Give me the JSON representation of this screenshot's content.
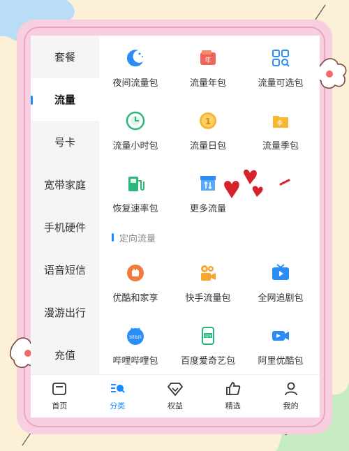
{
  "sidebar": {
    "items": [
      {
        "label": "套餐",
        "active": false
      },
      {
        "label": "流量",
        "active": true
      },
      {
        "label": "号卡",
        "active": false
      },
      {
        "label": "宽带家庭",
        "active": false
      },
      {
        "label": "手机硬件",
        "active": false
      },
      {
        "label": "语音短信",
        "active": false
      },
      {
        "label": "漫游出行",
        "active": false
      },
      {
        "label": "充值",
        "active": false
      }
    ]
  },
  "grid": {
    "items": [
      {
        "label": "夜间流量包",
        "icon": "moon-icon"
      },
      {
        "label": "流量年包",
        "icon": "year-package-icon"
      },
      {
        "label": "流量可选包",
        "icon": "grid-select-icon"
      },
      {
        "label": "流量小时包",
        "icon": "clock-icon"
      },
      {
        "label": "流量日包",
        "icon": "day-coin-icon"
      },
      {
        "label": "流量季包",
        "icon": "season-folder-icon"
      },
      {
        "label": "恢复速率包",
        "icon": "fuel-icon"
      },
      {
        "label": "更多流量",
        "icon": "store-icon"
      }
    ]
  },
  "section": {
    "title": "定向流量",
    "items": [
      {
        "label": "优酷和家享",
        "icon": "youku-icon"
      },
      {
        "label": "快手流量包",
        "icon": "kuaishou-icon"
      },
      {
        "label": "全网追剧包",
        "icon": "tv-play-icon"
      },
      {
        "label": "哔哩哔哩包",
        "icon": "bilibili-icon"
      },
      {
        "label": "百度爱奇艺包",
        "icon": "iqiyi-icon"
      },
      {
        "label": "阿里优酷包",
        "icon": "ali-youku-icon"
      }
    ]
  },
  "icon_text": {
    "year_badge": "年",
    "day_badge": "1",
    "season_badge": "季",
    "bilibili_badge": "bilibili",
    "iqiyi_badge": "iQIY"
  },
  "tabbar": {
    "items": [
      {
        "label": "首页",
        "active": false
      },
      {
        "label": "分类",
        "active": true
      },
      {
        "label": "权益",
        "active": false
      },
      {
        "label": "精选",
        "active": false
      },
      {
        "label": "我的",
        "active": false
      }
    ]
  },
  "colors": {
    "accent": "#1a8bff",
    "background": "#fcf1d6",
    "frame": "#f8cfe0"
  }
}
